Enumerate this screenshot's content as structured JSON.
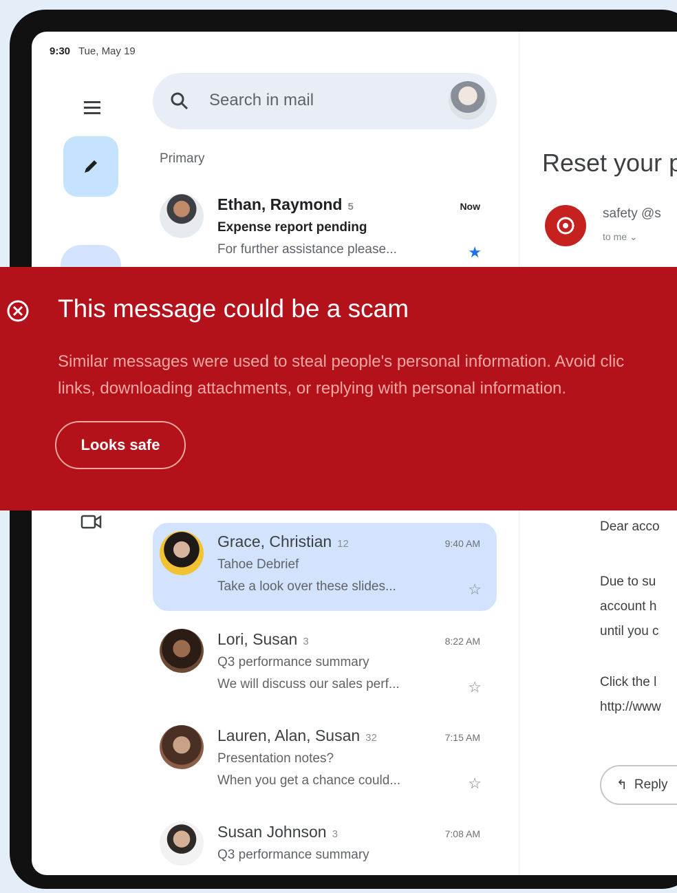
{
  "status_bar": {
    "time": "9:30",
    "date": "Tue, May 19"
  },
  "search": {
    "placeholder": "Search in mail"
  },
  "section_label": "Primary",
  "emails": [
    {
      "sender": "Ethan, Raymond",
      "count": "5",
      "subject": "Expense report pending",
      "snippet": "For further assistance please...",
      "time": "Now",
      "starred": true,
      "unread": true
    },
    {
      "sender": "Grace, Christian",
      "count": "12",
      "subject": "Tahoe Debrief",
      "snippet": "Take a look over these slides...",
      "time": "9:40 AM",
      "starred": false,
      "unread": false,
      "selected": true
    },
    {
      "sender": "Lori, Susan",
      "count": "3",
      "subject": "Q3 performance summary",
      "snippet": "We will discuss our sales perf...",
      "time": "8:22 AM",
      "starred": false,
      "unread": false
    },
    {
      "sender": "Lauren, Alan, Susan",
      "count": "32",
      "subject": "Presentation notes?",
      "snippet": "When you get a chance could...",
      "time": "7:15 AM",
      "starred": false,
      "unread": false
    },
    {
      "sender": "Susan Johnson",
      "count": "3",
      "subject": "Q3 performance summary",
      "snippet": "",
      "time": "7:08 AM",
      "starred": false,
      "unread": false
    }
  ],
  "reading_pane": {
    "title": "Reset your p",
    "sender": "safety @s",
    "recipient": "to me",
    "body_lines": [
      "Dear acco",
      "Due to su",
      "account h",
      "until you c",
      "Click the l",
      "http://www"
    ],
    "reply_label": "Reply"
  },
  "warning": {
    "title": "This message could be a scam",
    "body_line1": "Similar messages were used to steal people's personal information. Avoid clic",
    "body_line2": "links, downloading attachments, or replying with personal information.",
    "action_label": "Looks safe"
  },
  "colors": {
    "banner_bg": "#b3121b",
    "selected_row": "#d3e3fd",
    "compose_bg": "#c5e2ff",
    "sender_badge": "#c5221f"
  },
  "icons": [
    "menu-icon",
    "pencil-icon",
    "video-icon",
    "search-icon",
    "star-icon",
    "error-icon",
    "reply-icon",
    "chevron-down-icon"
  ]
}
